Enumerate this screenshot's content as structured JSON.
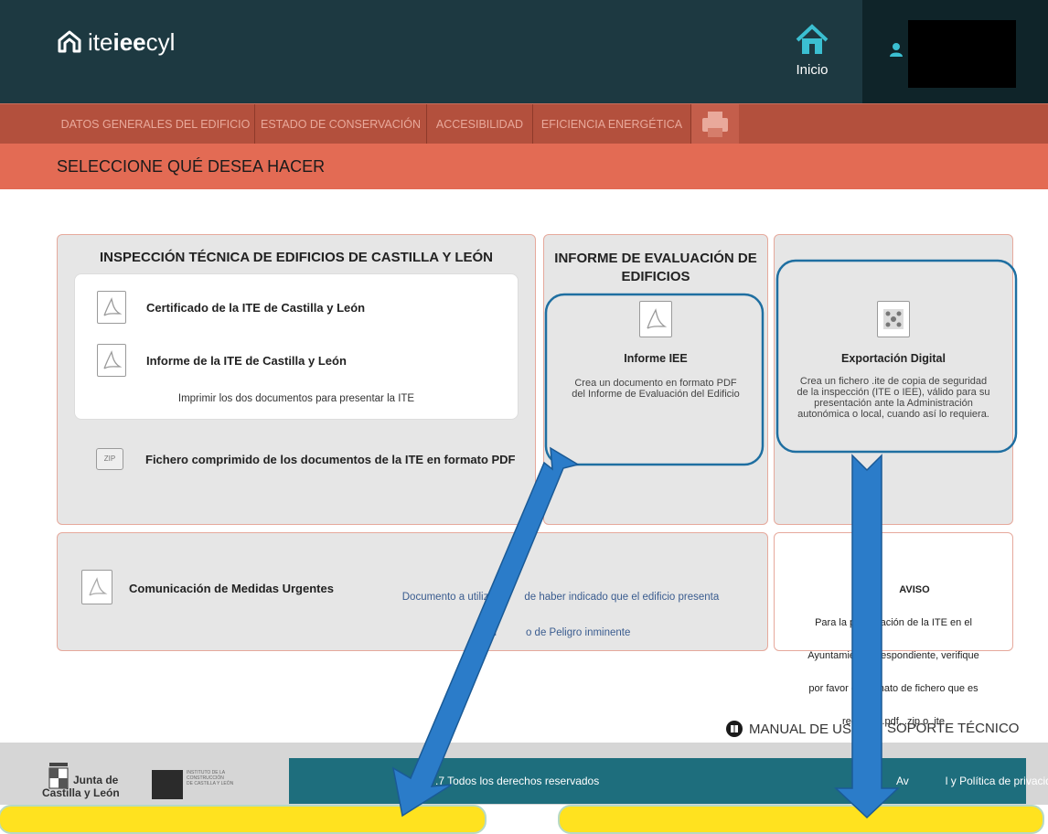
{
  "header": {
    "logo_prefix": "ite",
    "logo_bold": "iee",
    "logo_suffix": "cyl",
    "home_label": "Inicio"
  },
  "tabs": [
    {
      "label": "DATOS GENERALES DEL EDIFICIO"
    },
    {
      "label": "ESTADO DE CONSERVACIÓN"
    },
    {
      "label": "ACCESIBILIDAD"
    },
    {
      "label": "EFICIENCIA ENERGÉTICA"
    }
  ],
  "section_title": "SELECCIONE QUÉ DESEA HACER",
  "ite_card": {
    "title": "INSPECCIÓN TÉCNICA DE EDIFICIOS DE CASTILLA Y LEÓN",
    "item1": "Certificado de la ITE de Castilla y León",
    "item2": "Informe de la ITE de Castilla y León",
    "note": "Imprimir los dos documentos para presentar la ITE",
    "zip_item": "Fichero comprimido de los documentos de la ITE en formato PDF",
    "zip_icon_text": "ZIP"
  },
  "iee_card": {
    "title_line1": "INFORME DE EVALUACIÓN DE",
    "title_line2": "EDIFICIOS",
    "item_title": "Informe IEE",
    "item_desc": "Crea un documento en formato PDF del Informe de Evaluación del Edificio"
  },
  "export_card": {
    "item_title": "Exportación Digital",
    "item_desc": "Crea un fichero .ite de copia de seguridad de la inspección (ITE o IEE), válido para su presentación ante la Administración autonómica o local, cuando así lo requiera."
  },
  "urgent_card": {
    "label": "Comunicación de Medidas Urgentes",
    "desc_line1": "Documento a utilizar e      de haber indicado que el edificio presenta",
    "desc_line2": "u          o de Peligro inminente"
  },
  "notice_card": {
    "title": "AVISO",
    "line1": "Para la p         ación de la ITE en el",
    "line2": "Ayuntamien      respondiente, verifique",
    "line3": "por favor el      mato de fichero que es",
    "line4": "requ       .pdf, .zip o .ite"
  },
  "manual_link": "MANUAL DE US",
  "support_link": "SOPORTE TÉCNICO",
  "footer": {
    "junta_line1": "Junta de",
    "junta_line2": "Castilla y León",
    "instituto_line1": "INSTITUTO DE LA",
    "instituto_line2": "CONSTRUCCIÓN",
    "instituto_line3": "DE CASTILLA Y LEÓN",
    "copyright": ".7 Todos los derechos reservados",
    "privacy": "Av            l y Política de privacidad"
  },
  "colors": {
    "header_bg": "#1d3941",
    "tab_bg": "#b3503d",
    "title_bg": "#e36b54",
    "card_bg": "#e6e6e6",
    "highlight_border": "#1f6fa1",
    "arrow_fill": "#2b7cc9",
    "footer_band": "#1e6e7d",
    "yellow_box": "#ffe21f"
  }
}
